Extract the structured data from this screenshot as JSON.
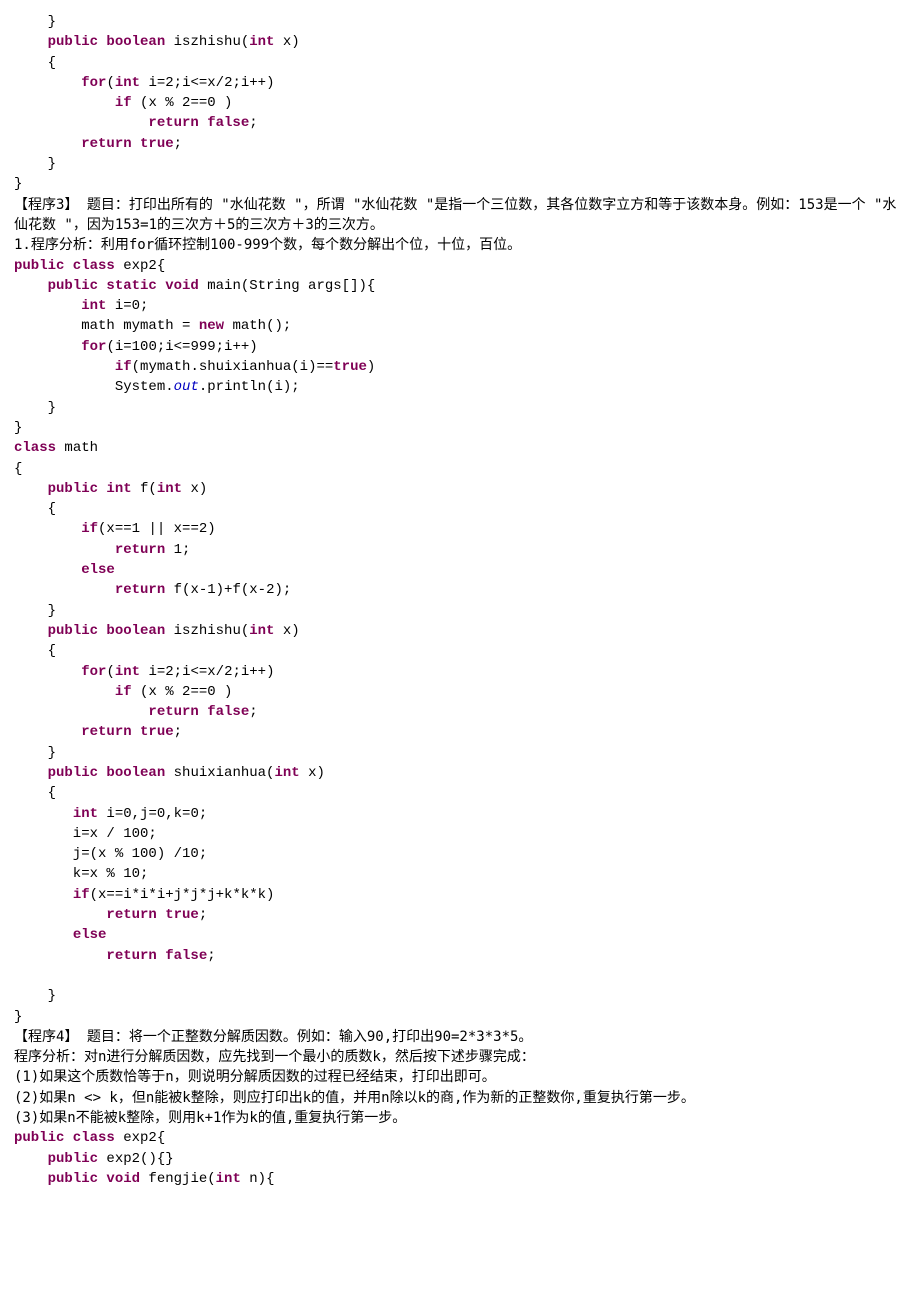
{
  "code1": {
    "l01": "    }",
    "l02a": "    ",
    "l02b": "public boolean",
    "l02c": " iszhishu(",
    "l02d": "int",
    "l02e": " x)",
    "l03": "    {",
    "l04a": "        ",
    "l04b": "for",
    "l04c": "(",
    "l04d": "int",
    "l04e": " i=2;i<=x/2;i++)",
    "l05a": "            ",
    "l05b": "if",
    "l05c": " (x % 2==0 )",
    "l06a": "                ",
    "l06b": "return false",
    "l06c": ";",
    "l07a": "        ",
    "l07b": "return true",
    "l07c": ";",
    "l08": "    }",
    "l09": "}"
  },
  "prog3": {
    "p1": "【程序3】   题目：打印出所有的 \"水仙花数 \"，所谓 \"水仙花数 \"是指一个三位数，其各位数字立方和等于该数本身。例如：153是一个 \"水仙花数 \"，因为153=1的三次方＋5的三次方＋3的三次方。",
    "p2": "1.程序分析：利用for循环控制100-999个数，每个数分解出个位，十位，百位。"
  },
  "code2": {
    "l01a": "public class",
    "l01b": " exp2{",
    "l02a": "    ",
    "l02b": "public static void",
    "l02c": " main(String args[]){",
    "l03a": "        ",
    "l03b": "int",
    "l03c": " i=0;",
    "l04a": "        math mymath = ",
    "l04b": "new",
    "l04c": " math();",
    "l05a": "        ",
    "l05b": "for",
    "l05c": "(i=100;i<=999;i++)",
    "l06a": "            ",
    "l06b": "if",
    "l06c": "(mymath.shuixianhua(i)==",
    "l06d": "true",
    "l06e": ")",
    "l07a": "            System.",
    "l07b": "out",
    "l07c": ".println(i);",
    "l08": "    }",
    "l09": "}",
    "l10a": "class",
    "l10b": " math",
    "l11": "{",
    "l12a": "    ",
    "l12b": "public int",
    "l12c": " f(",
    "l12d": "int",
    "l12e": " x)",
    "l13": "    {",
    "l14a": "        ",
    "l14b": "if",
    "l14c": "(x==1 || x==2)",
    "l15a": "            ",
    "l15b": "return",
    "l15c": " 1;",
    "l16a": "        ",
    "l16b": "else",
    "l17a": "            ",
    "l17b": "return",
    "l17c": " f(x-1)+f(x-2);",
    "l18": "    }",
    "l19a": "    ",
    "l19b": "public boolean",
    "l19c": " iszhishu(",
    "l19d": "int",
    "l19e": " x)",
    "l20": "    {",
    "l21a": "        ",
    "l21b": "for",
    "l21c": "(",
    "l21d": "int",
    "l21e": " i=2;i<=x/2;i++)",
    "l22a": "            ",
    "l22b": "if",
    "l22c": " (x % 2==0 )",
    "l23a": "                ",
    "l23b": "return false",
    "l23c": ";",
    "l24a": "        ",
    "l24b": "return true",
    "l24c": ";",
    "l25": "    }",
    "l26a": "    ",
    "l26b": "public boolean",
    "l26c": " shuixianhua(",
    "l26d": "int",
    "l26e": " x)",
    "l27": "    {",
    "l28a": "       ",
    "l28b": "int",
    "l28c": " i=0,j=0,k=0;",
    "l29": "       i=x / 100;",
    "l30": "       j=(x % 100) /10;",
    "l31": "       k=x % 10;",
    "l32a": "       ",
    "l32b": "if",
    "l32c": "(x==i*i*i+j*j*j+k*k*k)",
    "l33a": "           ",
    "l33b": "return true",
    "l33c": ";",
    "l34a": "       ",
    "l34b": "else",
    "l35a": "           ",
    "l35b": "return false",
    "l35c": ";",
    "l36": "",
    "l37": "    }",
    "l38": "}"
  },
  "prog4": {
    "p1": "【程序4】   题目：将一个正整数分解质因数。例如：输入90,打印出90=2*3*3*5。",
    "p2": "程序分析：对n进行分解质因数，应先找到一个最小的质数k，然后按下述步骤完成：",
    "p3": "(1)如果这个质数恰等于n，则说明分解质因数的过程已经结束，打印出即可。",
    "p4": "(2)如果n <> k，但n能被k整除，则应打印出k的值，并用n除以k的商,作为新的正整数你,重复执行第一步。",
    "p5": "(3)如果n不能被k整除，则用k+1作为k的值,重复执行第一步。"
  },
  "code3": {
    "l01a": "public class",
    "l01b": " exp2{",
    "l02a": "    ",
    "l02b": "public",
    "l02c": " exp2(){}",
    "l03a": "    ",
    "l03b": "public void",
    "l03c": " fengjie(",
    "l03d": "int",
    "l03e": " n){"
  }
}
